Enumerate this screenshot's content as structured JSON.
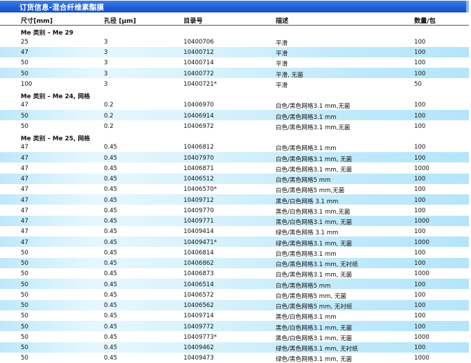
{
  "title": "订货信息-混合纤维素酯膜",
  "columns": [
    "尺寸[mm]",
    "孔径 [µm]",
    "目录号",
    "描述",
    "数量/包"
  ],
  "groups": [
    {
      "name": "Me 类别 – Me 29",
      "rows": [
        [
          "25",
          "3",
          "10400706",
          "平滑",
          "100"
        ],
        [
          "47",
          "3",
          "10400712",
          "平滑",
          "100"
        ],
        [
          "50",
          "3",
          "10400714",
          "平滑",
          "100"
        ],
        [
          "50",
          "3",
          "10400772",
          "平滑, 无菌",
          "100"
        ],
        [
          "100",
          "3",
          "10400721*",
          "平滑",
          "50"
        ]
      ]
    },
    {
      "name": "Me 类别 – Me 24, 网格",
      "rows": [
        [
          "47",
          "0.2",
          "10406970",
          "白色/黑色网格3.1 mm,无菌",
          "100"
        ],
        [
          "50",
          "0.2",
          "10406914",
          "白色/黑色网格3.1 mm",
          "100"
        ],
        [
          "50",
          "0.2",
          "10406972",
          "白色/黑色网格3.1 mm,无菌",
          "100"
        ]
      ]
    },
    {
      "name": "Me 类别 – Me 25, 网格",
      "rows": [
        [
          "47",
          "0.45",
          "10406812",
          "白色/黑色网格3.1 mm",
          "100"
        ],
        [
          "47",
          "0.45",
          "10407970",
          "白色/黑色网格3.1 mm, 无菌",
          "100"
        ],
        [
          "47",
          "0.45",
          "10406871",
          "白色/黑色网格3.1 mm, 无菌",
          "1000"
        ],
        [
          "47",
          "0.45",
          "10406512",
          "白色/黑色网格5 mm",
          "100"
        ],
        [
          "47",
          "0.45",
          "10406570*",
          "白色/黑色网格5 mm,无菌",
          "100"
        ],
        [
          "47",
          "0.45",
          "10409712",
          "黑色/白色网格 3.1 mm",
          "100"
        ],
        [
          "47",
          "0.45",
          "10409770",
          "黑色/白色网格3.1 mm,无菌",
          "100"
        ],
        [
          "47",
          "0.45",
          "10409771",
          "黑色/白色网格3.1 mm, 无菌",
          "1000"
        ],
        [
          "47",
          "0.45",
          "10409414",
          "绿色/黑色网格 3.1 mm",
          "100"
        ],
        [
          "47",
          "0.45",
          "10409471*",
          "绿色/黑色网格3.1 mm, 无菌",
          "1000"
        ],
        [
          "50",
          "0.45",
          "10406814",
          "白色/黑色网格3.1 mm",
          "100"
        ],
        [
          "50",
          "0.45",
          "10406862",
          "白色/黑色网格3.1 mm, 无衬纸",
          "100"
        ],
        [
          "50",
          "0.45",
          "10406873",
          "白色/黑色网格3.1 mm, 无菌",
          "1000"
        ],
        [
          "50",
          "0.45",
          "10406514",
          "白色/黑色网格5 mm",
          "100"
        ],
        [
          "50",
          "0.45",
          "10406572",
          "白色/黑色网格5 mm, 无菌",
          "100"
        ],
        [
          "50",
          "0.45",
          "10406562",
          "白色/黑色网格5 mm, 无衬纸",
          "100"
        ],
        [
          "50",
          "0.45",
          "10409714",
          "黑色/白色网格3.1 mm",
          "100"
        ],
        [
          "50",
          "0.45",
          "10409772",
          "黑色/白色网格3.1 mm, 无菌",
          "100"
        ],
        [
          "50",
          "0.45",
          "10409773*",
          "黑色/白色网格3.1 mm, 无菌",
          "1000"
        ],
        [
          "50",
          "0.45",
          "10409462",
          "绿色/黑色网格3.1 mm, 无衬纸",
          "100"
        ],
        [
          "50",
          "0.45",
          "10409473",
          "绿色/黑色网格3.1 mm, 无菌",
          "1000"
        ]
      ]
    }
  ]
}
